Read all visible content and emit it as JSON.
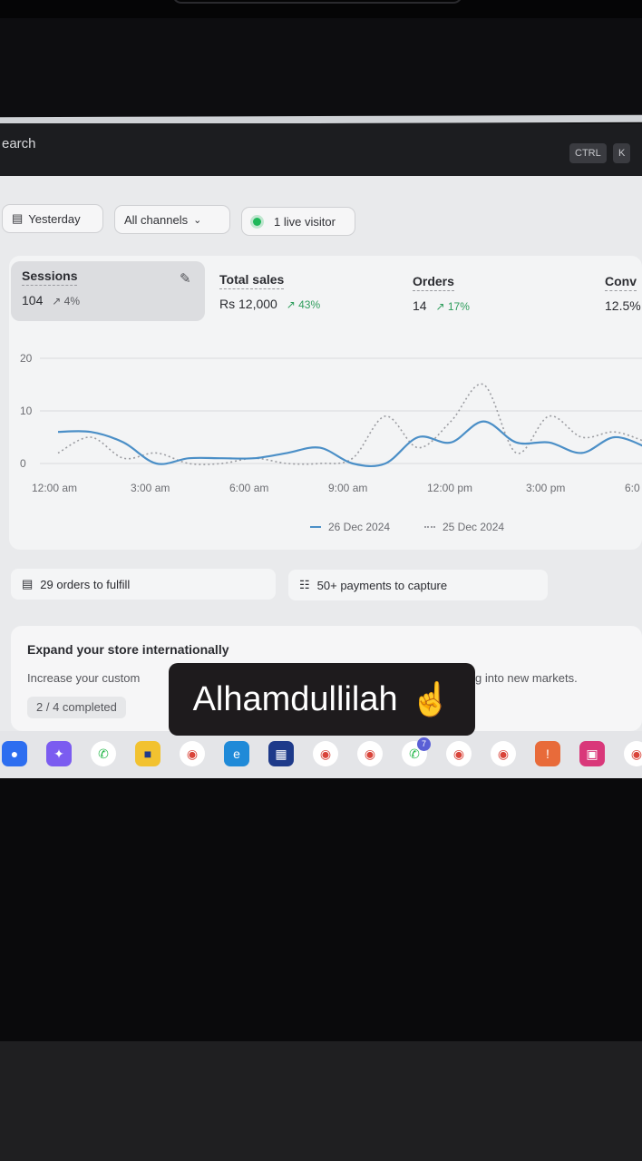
{
  "search": {
    "label": "earch",
    "shortcut_ctrl": "CTRL",
    "shortcut_key": "K"
  },
  "filters": {
    "date": "Yesterday",
    "channels": "All channels",
    "live": "1 live visitor"
  },
  "metrics": {
    "sessions": {
      "label": "Sessions",
      "value": "104",
      "change": "4%"
    },
    "total_sales": {
      "label": "Total sales",
      "value": "Rs 12,000",
      "change": "43%"
    },
    "orders": {
      "label": "Orders",
      "value": "14",
      "change": "17%"
    },
    "conversion": {
      "label": "Conv",
      "value": "12.5%"
    }
  },
  "chart_data": {
    "type": "line",
    "x": [
      "12:00 am",
      "1:00 am",
      "2:00 am",
      "3:00 am",
      "4:00 am",
      "5:00 am",
      "6:00 am",
      "7:00 am",
      "8:00 am",
      "9:00 am",
      "10:00 am",
      "11:00 am",
      "12:00 pm",
      "1:00 pm",
      "2:00 pm",
      "3:00 pm",
      "4:00 pm",
      "5:00 pm",
      "6:00 pm"
    ],
    "x_tick_labels": [
      "12:00 am",
      "3:00 am",
      "6:00 am",
      "9:00 am",
      "12:00 pm",
      "3:00 pm",
      "6:0"
    ],
    "y_tick_labels": [
      "20",
      "10",
      "0"
    ],
    "ylim": [
      0,
      20
    ],
    "series": [
      {
        "name": "26 Dec 2024",
        "style": "solid",
        "color": "#4b8fc7",
        "values": [
          6,
          6,
          4,
          0,
          1,
          1,
          1,
          2,
          3,
          0,
          0,
          5,
          4,
          8,
          4,
          4,
          2,
          5,
          3
        ]
      },
      {
        "name": "25 Dec 2024",
        "style": "dotted",
        "color": "#9c9da2",
        "values": [
          2,
          5,
          1,
          2,
          0,
          0,
          1,
          0,
          0,
          1,
          9,
          3,
          8,
          15,
          2,
          9,
          5,
          6,
          4
        ]
      }
    ],
    "legend_position": "bottom",
    "grid": true
  },
  "tasks": {
    "orders_to_fulfill": "29 orders to fulfill",
    "payments_to_capture": "50+ payments to capture"
  },
  "expand": {
    "title": "Expand your store internationally",
    "desc_left": "Increase your custom",
    "desc_right": "g into new markets.",
    "progress": "2 / 4 completed"
  },
  "overlay": {
    "text": "Alhamdullilah",
    "emoji": "☝"
  },
  "taskbar_icons": [
    "zoom-icon",
    "copilot-icon",
    "whatsapp-icon",
    "file-explorer-icon",
    "chrome-icon",
    "edge-icon",
    "microsoft-store-icon",
    "chrome-icon",
    "chrome-icon",
    "whatsapp-icon",
    "chrome-icon",
    "chrome-icon",
    "messenger-icon",
    "instagram-icon",
    "chrome-icon"
  ],
  "taskbar_badge": "7"
}
